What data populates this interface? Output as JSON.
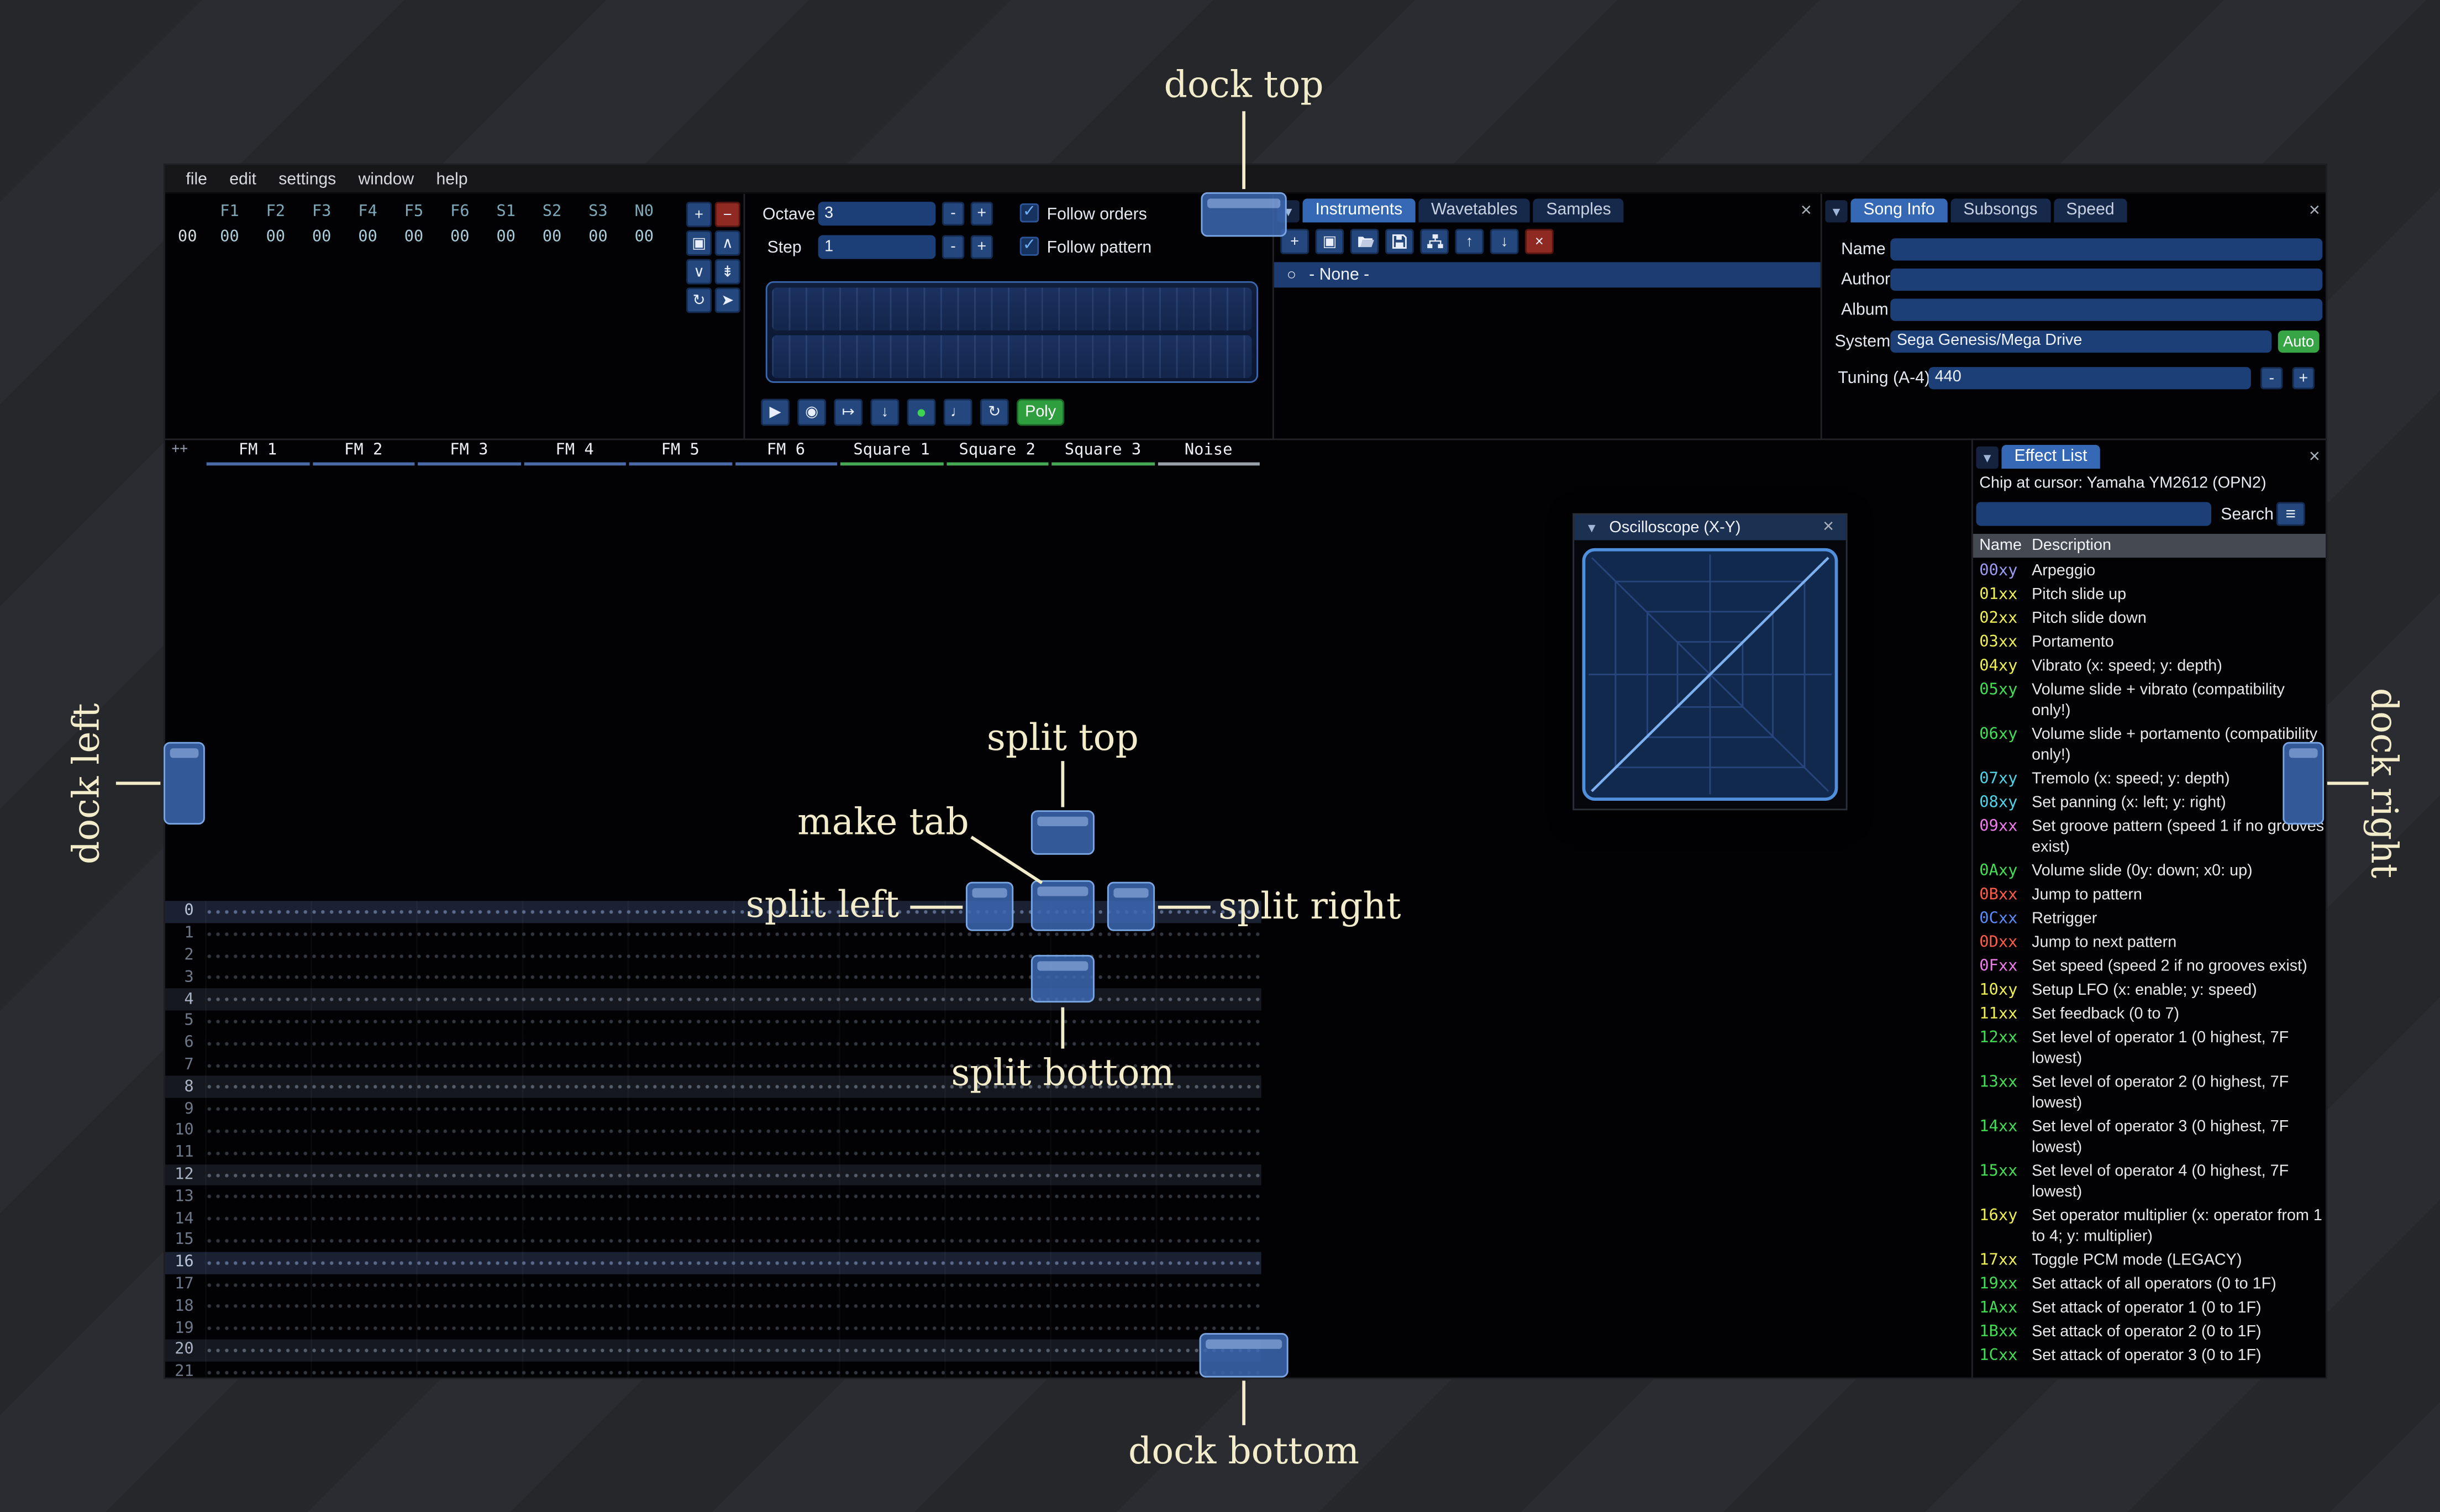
{
  "annotations": {
    "dock_top": "dock top",
    "dock_left": "dock left",
    "dock_right": "dock right",
    "dock_bottom": "dock bottom",
    "split_top": "split top",
    "split_left": "split left",
    "split_right": "split right",
    "split_bottom": "split bottom",
    "make_tab": "make tab"
  },
  "ui": {
    "close": "×",
    "collapse": "▼",
    "radio": "○",
    "check": "✓",
    "burger": "≡",
    "corner_plus": "++"
  },
  "menu": {
    "items": [
      "file",
      "edit",
      "settings",
      "window",
      "help"
    ]
  },
  "orders": {
    "channel_headers": [
      "F1",
      "F2",
      "F3",
      "F4",
      "F5",
      "F6",
      "S1",
      "S2",
      "S3",
      "N0"
    ],
    "rows": [
      {
        "index": "00",
        "values": [
          "00",
          "00",
          "00",
          "00",
          "00",
          "00",
          "00",
          "00",
          "00",
          "00"
        ]
      }
    ],
    "buttons": [
      {
        "name": "add",
        "glyph": "+",
        "style": "blue"
      },
      {
        "name": "remove",
        "glyph": "−",
        "style": "red"
      },
      {
        "name": "duplicate",
        "glyph": "▣",
        "style": "blue"
      },
      {
        "name": "move-up",
        "glyph": "∧",
        "style": "blue"
      },
      {
        "name": "move-down",
        "glyph": "∨",
        "style": "blue"
      },
      {
        "name": "deep-clone",
        "glyph": "⇟",
        "style": "blue"
      },
      {
        "name": "change-all",
        "glyph": "↻",
        "style": "blue"
      },
      {
        "name": "edit-mode",
        "glyph": "➤",
        "style": "blue"
      }
    ]
  },
  "controls": {
    "octave_label": "Octave",
    "octave_value": "3",
    "step_label": "Step",
    "step_value": "1",
    "minus": "-",
    "plus": "+",
    "follow_orders": "Follow orders",
    "follow_pattern": "Follow pattern",
    "playback": [
      {
        "name": "play",
        "glyph": "▶"
      },
      {
        "name": "play-pattern",
        "glyph": "◉"
      },
      {
        "name": "play-from-cursor",
        "glyph": "↦"
      },
      {
        "name": "step-row",
        "glyph": "↓"
      },
      {
        "name": "record",
        "glyph": "●",
        "style": "record"
      },
      {
        "name": "metronome",
        "glyph": "♩"
      },
      {
        "name": "repeat-pattern",
        "glyph": "↻"
      }
    ],
    "poly_label": "Poly"
  },
  "assets": {
    "tabs": [
      {
        "label": "Instruments",
        "selected": true
      },
      {
        "label": "Wavetables",
        "selected": false
      },
      {
        "label": "Samples",
        "selected": false
      }
    ],
    "toolbar": [
      {
        "name": "add",
        "glyph": "+",
        "style": "blue"
      },
      {
        "name": "duplicate",
        "glyph": "▣",
        "style": "blue"
      },
      {
        "name": "open",
        "icon": "folder",
        "style": "blue"
      },
      {
        "name": "save",
        "icon": "floppy",
        "style": "blue"
      },
      {
        "name": "organize",
        "icon": "sitemap",
        "style": "blue"
      },
      {
        "name": "move-up",
        "glyph": "↑",
        "style": "blue"
      },
      {
        "name": "move-down",
        "glyph": "↓",
        "style": "blue"
      },
      {
        "name": "delete",
        "glyph": "×",
        "style": "red"
      }
    ],
    "list": [
      {
        "label": "- None -",
        "selected": true
      }
    ]
  },
  "song_info": {
    "tabs": [
      {
        "label": "Song Info",
        "selected": true
      },
      {
        "label": "Subsongs",
        "selected": false
      },
      {
        "label": "Speed",
        "selected": false
      }
    ],
    "name_label": "Name",
    "name_value": "",
    "author_label": "Author",
    "author_value": "",
    "album_label": "Album",
    "album_value": "",
    "system_label": "System",
    "system_value": "Sega Genesis/Mega Drive",
    "auto_label": "Auto",
    "tuning_label": "Tuning (A-4)",
    "tuning_value": "440",
    "minus": "-",
    "plus": "+"
  },
  "pattern": {
    "corner": "++",
    "channels": [
      {
        "name": "FM 1",
        "type": "fm"
      },
      {
        "name": "FM 2",
        "type": "fm"
      },
      {
        "name": "FM 3",
        "type": "fm"
      },
      {
        "name": "FM 4",
        "type": "fm"
      },
      {
        "name": "FM 5",
        "type": "fm"
      },
      {
        "name": "FM 6",
        "type": "fm"
      },
      {
        "name": "Square 1",
        "type": "sq"
      },
      {
        "name": "Square 2",
        "type": "sq"
      },
      {
        "name": "Square 3",
        "type": "sq"
      },
      {
        "name": "Noise",
        "type": "noise"
      }
    ],
    "rows": [
      "0",
      "1",
      "2",
      "3",
      "4",
      "5",
      "6",
      "7",
      "8",
      "9",
      "10",
      "11",
      "12",
      "13",
      "14",
      "15",
      "16",
      "17",
      "18",
      "19",
      "20",
      "21"
    ]
  },
  "oscilloscope": {
    "title": "Oscilloscope (X-Y)"
  },
  "effect_list": {
    "tab": "Effect List",
    "chip": "Chip at cursor: Yamaha YM2612 (OPN2)",
    "search_label": "Search",
    "search_value": "",
    "columns": {
      "name": "Name",
      "desc": "Description"
    },
    "effects": [
      {
        "code": "00xy",
        "color": "#9b9bf0",
        "desc": "Arpeggio"
      },
      {
        "code": "01xx",
        "color": "#eeee55",
        "desc": "Pitch slide up"
      },
      {
        "code": "02xx",
        "color": "#eeee55",
        "desc": "Pitch slide down"
      },
      {
        "code": "03xx",
        "color": "#eeee55",
        "desc": "Portamento"
      },
      {
        "code": "04xy",
        "color": "#eeee55",
        "desc": "Vibrato (x: speed; y: depth)"
      },
      {
        "code": "05xy",
        "color": "#43dd55",
        "desc": "Volume slide + vibrato (compatibility only!)"
      },
      {
        "code": "06xy",
        "color": "#43dd55",
        "desc": "Volume slide + portamento (compatibility only!)"
      },
      {
        "code": "07xy",
        "color": "#4fd2e5",
        "desc": "Tremolo (x: speed; y: depth)"
      },
      {
        "code": "08xy",
        "color": "#4fd2e5",
        "desc": "Set panning (x: left; y: right)"
      },
      {
        "code": "09xx",
        "color": "#ef7bea",
        "desc": "Set groove pattern (speed 1 if no grooves exist)"
      },
      {
        "code": "0Axy",
        "color": "#43dd55",
        "desc": "Volume slide (0y: down; x0: up)"
      },
      {
        "code": "0Bxx",
        "color": "#fa5c49",
        "desc": "Jump to pattern"
      },
      {
        "code": "0Cxx",
        "color": "#5b8bfa",
        "desc": "Retrigger"
      },
      {
        "code": "0Dxx",
        "color": "#fa5c49",
        "desc": "Jump to next pattern"
      },
      {
        "code": "0Fxx",
        "color": "#ef7bea",
        "desc": "Set speed (speed 2 if no grooves exist)"
      },
      {
        "code": "10xy",
        "color": "#eeee55",
        "desc": "Setup LFO (x: enable; y: speed)"
      },
      {
        "code": "11xx",
        "color": "#eeee55",
        "desc": "Set feedback (0 to 7)"
      },
      {
        "code": "12xx",
        "color": "#43dd55",
        "desc": "Set level of operator 1 (0 highest, 7F lowest)"
      },
      {
        "code": "13xx",
        "color": "#43dd55",
        "desc": "Set level of operator 2 (0 highest, 7F lowest)"
      },
      {
        "code": "14xx",
        "color": "#43dd55",
        "desc": "Set level of operator 3 (0 highest, 7F lowest)"
      },
      {
        "code": "15xx",
        "color": "#43dd55",
        "desc": "Set level of operator 4 (0 highest, 7F lowest)"
      },
      {
        "code": "16xy",
        "color": "#eeee55",
        "desc": "Set operator multiplier (x: operator from 1 to 4; y: multiplier)"
      },
      {
        "code": "17xx",
        "color": "#eeee55",
        "desc": "Toggle PCM mode (LEGACY)"
      },
      {
        "code": "19xx",
        "color": "#43dd55",
        "desc": "Set attack of all operators (0 to 1F)"
      },
      {
        "code": "1Axx",
        "color": "#43dd55",
        "desc": "Set attack of operator 1 (0 to 1F)"
      },
      {
        "code": "1Bxx",
        "color": "#43dd55",
        "desc": "Set attack of operator 2 (0 to 1F)"
      },
      {
        "code": "1Cxx",
        "color": "#43dd55",
        "desc": "Set attack of operator 3 (0 to 1F)"
      }
    ]
  },
  "colors": {
    "accent_tab": "#3568b5",
    "overlay_button": "#3d68b2",
    "annotation": "#f2ecca",
    "record_green": "#3fd44f"
  }
}
